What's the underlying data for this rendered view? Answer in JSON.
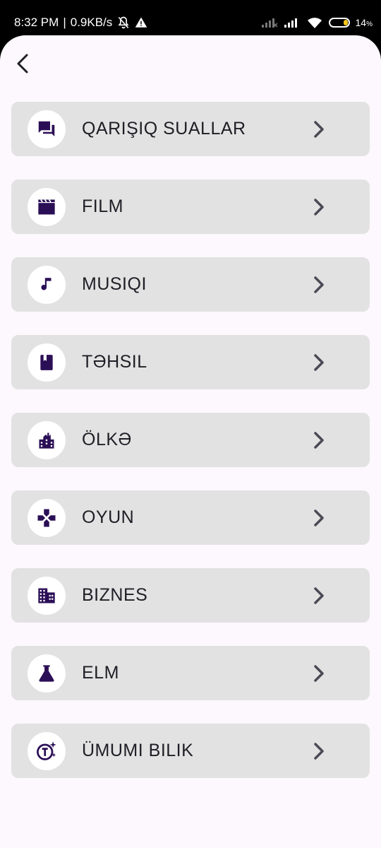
{
  "status_bar": {
    "time": "8:32 PM",
    "separator": "|",
    "speed": "0.9KB/s",
    "battery": "14",
    "battery_unit": "%"
  },
  "colors": {
    "icon_color": "#2b0f56",
    "card_bg": "#e2e2e2",
    "label_color": "#1e1e26",
    "background": "#fdf8fd"
  },
  "categories": [
    {
      "label": "QARIŞIQ SUALLAR",
      "icon": "forum-icon"
    },
    {
      "label": "FILM",
      "icon": "movie-clapper-icon"
    },
    {
      "label": "MUSIQI",
      "icon": "music-note-icon"
    },
    {
      "label": "TƏHSIL",
      "icon": "book-icon"
    },
    {
      "label": "ÖLKƏ",
      "icon": "city-icon"
    },
    {
      "label": "OYUN",
      "icon": "gamepad-icon"
    },
    {
      "label": "BIZNES",
      "icon": "business-building-icon"
    },
    {
      "label": "ELM",
      "icon": "science-flask-icon"
    },
    {
      "label": "ÜMUMI BILIK",
      "icon": "general-knowledge-icon"
    }
  ]
}
